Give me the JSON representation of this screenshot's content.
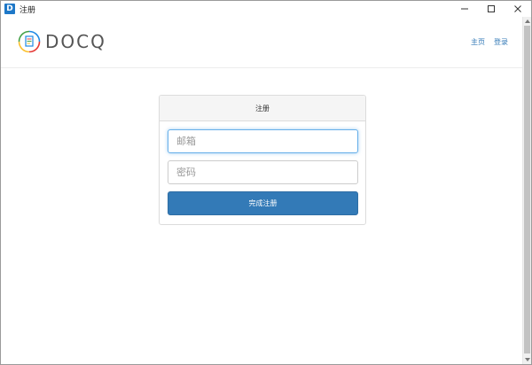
{
  "window": {
    "title": "注册",
    "app_icon_letter": "D",
    "controls": [
      "minimize-icon",
      "maximize-icon",
      "close-icon"
    ]
  },
  "navbar": {
    "brand": "DOCQ",
    "links": [
      {
        "label": "主页"
      },
      {
        "label": "登录"
      }
    ]
  },
  "form": {
    "heading": "注册",
    "email_placeholder": "邮箱",
    "password_placeholder": "密码",
    "submit_label": "完成注册"
  },
  "colors": {
    "primary": "#337ab7",
    "link": "#337ab7",
    "focus": "#66afe9",
    "logo_blue": "#1e88e5",
    "logo_red": "#e53935",
    "logo_green": "#43a047",
    "logo_yellow": "#fbc02d"
  }
}
